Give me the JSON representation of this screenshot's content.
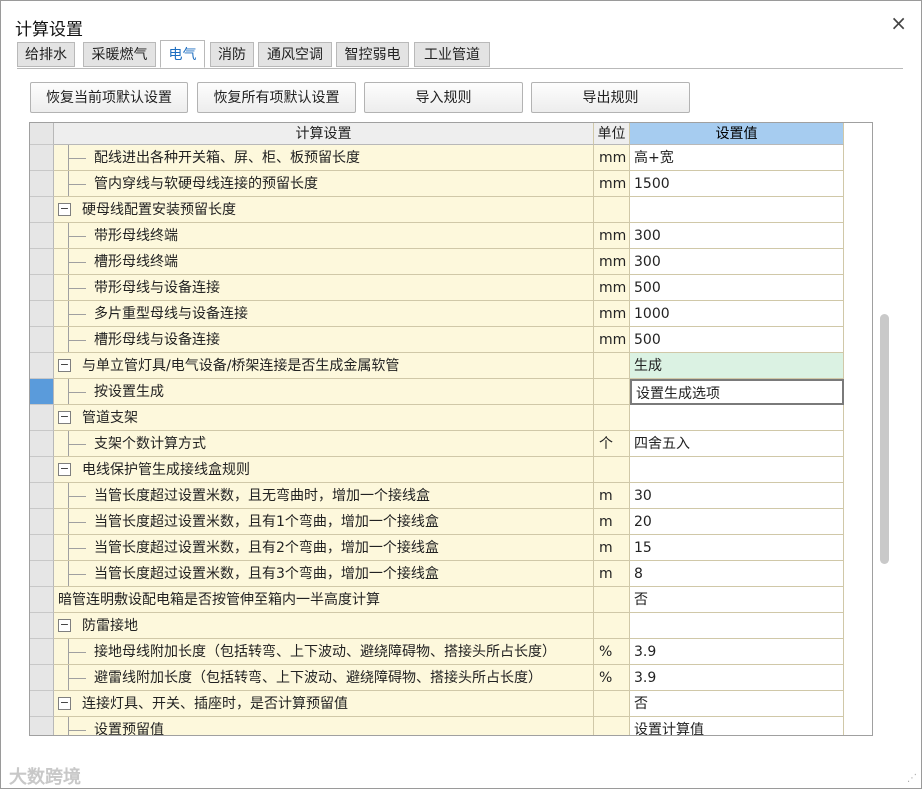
{
  "window": {
    "title": "计算设置",
    "close": "×"
  },
  "tabs": [
    {
      "label": "给排水",
      "active": false
    },
    {
      "label": "采暖燃气",
      "active": false
    },
    {
      "label": "电气",
      "active": true
    },
    {
      "label": "消防",
      "active": false
    },
    {
      "label": "通风空调",
      "active": false
    },
    {
      "label": "智控弱电",
      "active": false
    },
    {
      "label": "工业管道",
      "active": false
    }
  ],
  "toolbar": {
    "restore_current": "恢复当前项默认设置",
    "restore_all": "恢复所有项默认设置",
    "import_rules": "导入规则",
    "export_rules": "导出规则"
  },
  "grid": {
    "headers": {
      "setting": "计算设置",
      "unit": "单位",
      "value": "设置值"
    },
    "rows": [
      {
        "label": "配线进出各种开关箱、屏、柜、板预留长度",
        "unit": "mm",
        "value": "高+宽",
        "level": 1
      },
      {
        "label": "管内穿线与软硬母线连接的预留长度",
        "unit": "mm",
        "value": "1500",
        "level": 1
      },
      {
        "label": "硬母线配置安装预留长度",
        "unit": "",
        "value": "",
        "level": 0,
        "group": true,
        "expander": "−"
      },
      {
        "label": "带形母线终端",
        "unit": "mm",
        "value": "300",
        "level": 1
      },
      {
        "label": "槽形母线终端",
        "unit": "mm",
        "value": "300",
        "level": 1
      },
      {
        "label": "带形母线与设备连接",
        "unit": "mm",
        "value": "500",
        "level": 1
      },
      {
        "label": "多片重型母线与设备连接",
        "unit": "mm",
        "value": "1000",
        "level": 1
      },
      {
        "label": "槽形母线与设备连接",
        "unit": "mm",
        "value": "500",
        "level": 1
      },
      {
        "label": "与单立管灯具/电气设备/桥架连接是否生成金属软管",
        "unit": "",
        "value": "生成",
        "level": 0,
        "group": true,
        "expander": "−",
        "highlight": true
      },
      {
        "label": "按设置生成",
        "unit": "",
        "value": "设置生成选项",
        "level": 1,
        "selected": true,
        "editing": true
      },
      {
        "label": "管道支架",
        "unit": "",
        "value": "",
        "level": 0,
        "group": true,
        "expander": "−"
      },
      {
        "label": "支架个数计算方式",
        "unit": "个",
        "value": "四舍五入",
        "level": 1
      },
      {
        "label": "电线保护管生成接线盒规则",
        "unit": "",
        "value": "",
        "level": 0,
        "group": true,
        "expander": "−"
      },
      {
        "label": "当管长度超过设置米数，且无弯曲时，增加一个接线盒",
        "unit": "m",
        "value": "30",
        "level": 1
      },
      {
        "label": "当管长度超过设置米数，且有1个弯曲，增加一个接线盒",
        "unit": "m",
        "value": "20",
        "level": 1
      },
      {
        "label": "当管长度超过设置米数，且有2个弯曲，增加一个接线盒",
        "unit": "m",
        "value": "15",
        "level": 1
      },
      {
        "label": "当管长度超过设置米数，且有3个弯曲，增加一个接线盒",
        "unit": "m",
        "value": "8",
        "level": 1
      },
      {
        "label": "暗管连明敷设配电箱是否按管伸至箱内一半高度计算",
        "unit": "",
        "value": "否",
        "level": -1
      },
      {
        "label": "防雷接地",
        "unit": "",
        "value": "",
        "level": 0,
        "group": true,
        "expander": "−"
      },
      {
        "label": "接地母线附加长度（包括转弯、上下波动、避绕障碍物、搭接头所占长度）",
        "unit": "%",
        "value": "3.9",
        "level": 1
      },
      {
        "label": "避雷线附加长度（包括转弯、上下波动、避绕障碍物、搭接头所占长度）",
        "unit": "%",
        "value": "3.9",
        "level": 1
      },
      {
        "label": "连接灯具、开关、插座时，是否计算预留值",
        "unit": "",
        "value": "否",
        "level": 0,
        "group": true,
        "expander": "−"
      },
      {
        "label": "设置预留值",
        "unit": "",
        "value": "设置计算值",
        "level": 1
      }
    ]
  },
  "watermark": "大数跨境"
}
